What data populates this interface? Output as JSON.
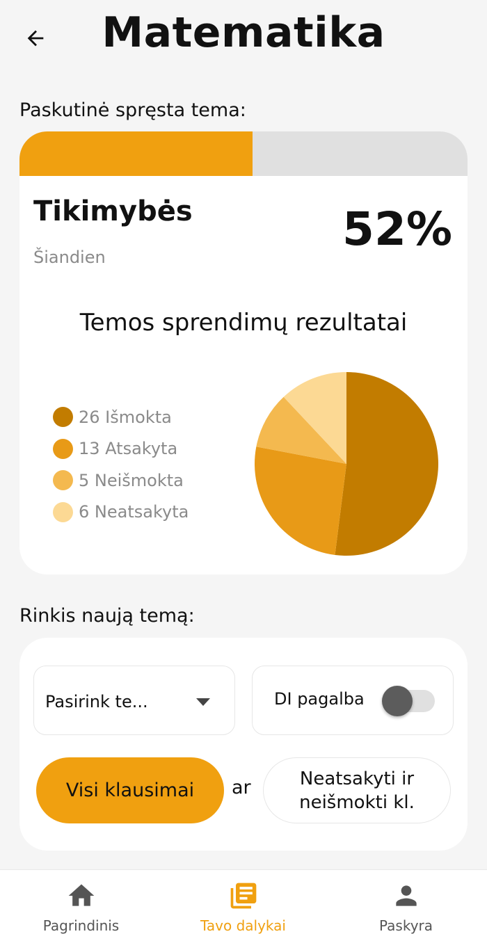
{
  "header": {
    "title": "Matematika",
    "back_icon": "arrow-left-icon"
  },
  "last_topic": {
    "section_label": "Paskutinė spręsta tema:",
    "name": "Tikimybės",
    "date": "Šiandien",
    "percent": "52%",
    "progress_fraction": 0.52,
    "results_title": "Temos sprendimų rezultatai",
    "legend": [
      {
        "label": "26 Išmokta",
        "color": "#c27c00"
      },
      {
        "label": "13 Atsakyta",
        "color": "#e89a17"
      },
      {
        "label": "5 Neišmokta",
        "color": "#f4b94f"
      },
      {
        "label": "6 Neatsakyta",
        "color": "#fcd994"
      }
    ]
  },
  "chart_data": {
    "type": "pie",
    "categories": [
      "Išmokta",
      "Atsakyta",
      "Neišmokta",
      "Neatsakyta"
    ],
    "values": [
      26,
      13,
      5,
      6
    ],
    "colors": [
      "#c27c00",
      "#e89a17",
      "#f4b94f",
      "#fcd994"
    ],
    "title": "Temos sprendimų rezultatai",
    "legend_position": "left"
  },
  "new_topic": {
    "section_label": "Rinkis naują temą:",
    "select_value": "Pasirink te...",
    "ai_label": "DI pagalba",
    "ai_enabled": false,
    "all_button": "Visi klausimai",
    "or_text": "ar",
    "unanswered_button_line1": "Neatsakyti ir",
    "unanswered_button_line2": "neišmokti kl."
  },
  "bottom_nav": {
    "items": [
      {
        "label": "Pagrindinis",
        "icon": "home-icon",
        "active": false
      },
      {
        "label": "Tavo dalykai",
        "icon": "library-icon",
        "active": true
      },
      {
        "label": "Paskyra",
        "icon": "person-icon",
        "active": false
      }
    ]
  },
  "colors": {
    "accent": "#f0a010",
    "background": "#f5f5f5",
    "progress_track": "#e0e0e0"
  }
}
